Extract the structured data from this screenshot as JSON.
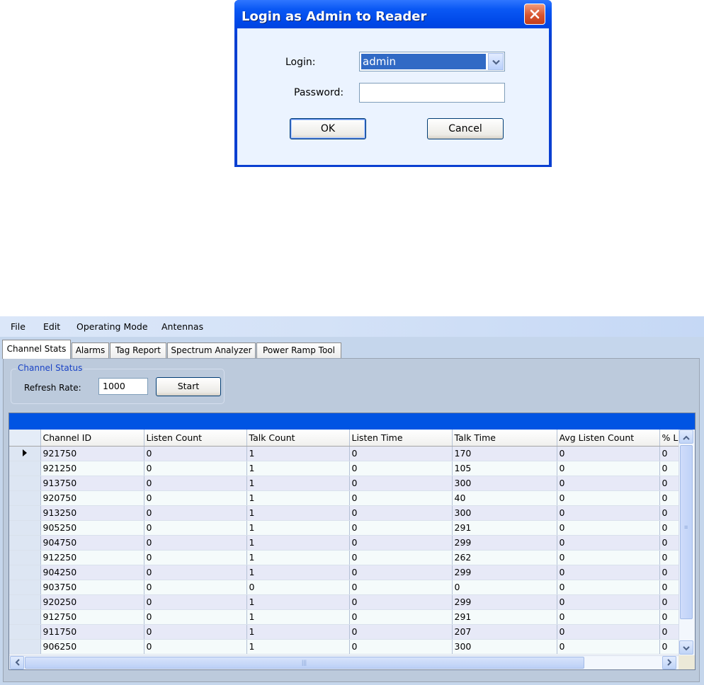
{
  "dialog": {
    "title": "Login as Admin to Reader",
    "login_label": "Login:",
    "login_value": "admin",
    "password_label": "Password:",
    "password_value": "",
    "ok_label": "OK",
    "cancel_label": "Cancel"
  },
  "menu": [
    "File",
    "Edit",
    "Operating Mode",
    "Antennas"
  ],
  "tabs": [
    "Channel Stats",
    "Alarms",
    "Tag Report",
    "Spectrum Analyzer",
    "Power Ramp Tool"
  ],
  "active_tab": "Channel Stats",
  "channel_status": {
    "group_title": "Channel Status",
    "refresh_label": "Refresh Rate:",
    "refresh_value": "1000",
    "start_label": "Start"
  },
  "grid": {
    "columns": [
      "Channel ID",
      "Listen Count",
      "Talk Count",
      "Listen Time",
      "Talk Time",
      "Avg Listen Count",
      "% L"
    ],
    "rows": [
      [
        "921750",
        "0",
        "1",
        "0",
        "170",
        "0",
        "0"
      ],
      [
        "921250",
        "0",
        "1",
        "0",
        "105",
        "0",
        "0"
      ],
      [
        "913750",
        "0",
        "1",
        "0",
        "300",
        "0",
        "0"
      ],
      [
        "920750",
        "0",
        "1",
        "0",
        "40",
        "0",
        "0"
      ],
      [
        "913250",
        "0",
        "1",
        "0",
        "300",
        "0",
        "0"
      ],
      [
        "905250",
        "0",
        "1",
        "0",
        "291",
        "0",
        "0"
      ],
      [
        "904750",
        "0",
        "1",
        "0",
        "299",
        "0",
        "0"
      ],
      [
        "912250",
        "0",
        "1",
        "0",
        "262",
        "0",
        "0"
      ],
      [
        "904250",
        "0",
        "1",
        "0",
        "299",
        "0",
        "0"
      ],
      [
        "903750",
        "0",
        "0",
        "0",
        "0",
        "0",
        "0"
      ],
      [
        "920250",
        "0",
        "1",
        "0",
        "299",
        "0",
        "0"
      ],
      [
        "912750",
        "0",
        "1",
        "0",
        "291",
        "0",
        "0"
      ],
      [
        "911750",
        "0",
        "1",
        "0",
        "207",
        "0",
        "0"
      ],
      [
        "906250",
        "0",
        "1",
        "0",
        "300",
        "0",
        "0"
      ]
    ],
    "selected_row": 0
  },
  "icons": {
    "close": "close-icon",
    "dropdown": "chevron-down-icon",
    "row_pointer": "row-pointer-icon",
    "scroll_up": "arrow-up-icon",
    "scroll_down": "arrow-down-icon",
    "scroll_left": "arrow-left-icon",
    "scroll_right": "arrow-right-icon"
  },
  "colors": {
    "dialog_title": "#0058ee",
    "grid_caption": "#0054e3",
    "group_title": "#1a43c6"
  }
}
